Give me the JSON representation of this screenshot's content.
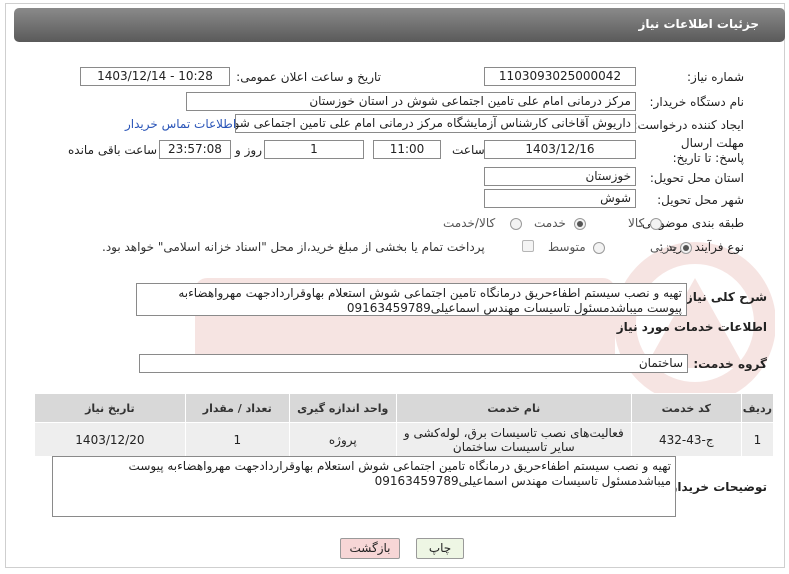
{
  "header": {
    "title": "جزئیات اطلاعات نیاز"
  },
  "fields": {
    "need_number_label": "شماره نیاز:",
    "need_number": "1103093025000042",
    "announce_label": "تاریخ و ساعت اعلان عمومی:",
    "announce_value": "1403/12/14 - 10:28",
    "buyer_org_label": "نام دستگاه خریدار:",
    "buyer_org": "مرکز درمانی امام علی تامین اجتماعی شوش در استان خوزستان",
    "requester_label": "ایجاد کننده درخواست:",
    "requester": "داریوش آقاخانی کارشناس آزمایشگاه مرکز درمانی امام علی تامین اجتماعی شوش",
    "contact_link": "اطلاعات تماس خریدار",
    "deadline_label": "مهلت ارسال پاسخ: تا تاریخ:",
    "deadline_date": "1403/12/16",
    "time_label": "ساعت",
    "deadline_time": "11:00",
    "days_value": "1",
    "days_label": "روز و",
    "remaining_time": "23:57:08",
    "remaining_label": "ساعت باقی مانده",
    "province_label": "استان محل تحویل:",
    "province": "خوزستان",
    "city_label": "شهر محل تحویل:",
    "city": "شوش",
    "category_label": "طبقه بندی موضوعی:",
    "category_options": [
      "کالا",
      "خدمت",
      "کالا/خدمت"
    ],
    "process_label": "نوع فرآیند خرید :",
    "process_options": [
      "جزیی",
      "متوسط"
    ],
    "payment_note": "پرداخت تمام یا بخشی از مبلغ خرید،از محل \"اسناد خزانه اسلامی\" خواهد بود."
  },
  "summary": {
    "label": "شرح کلی نیاز:",
    "text": "تهیه و نصب سیستم اطفاءحریق درمانگاه تامین اجتماعی شوش استعلام بهاوقراردادجهت مهرواهضاءبه پیوست میباشدمسئول تاسیسات مهندس اسماعیلی09163459789"
  },
  "services": {
    "section_title": "اطلاعات خدمات مورد نیاز",
    "group_label": "گروه خدمت:",
    "group_value": "ساختمان",
    "columns": [
      "ردیف",
      "کد خدمت",
      "نام خدمت",
      "واحد اندازه گیری",
      "تعداد / مقدار",
      "تاریخ نیاز"
    ],
    "rows": [
      {
        "row": "1",
        "code": "ج-43-432",
        "name": "فعالیت‌های نصب تاسیسات برق، لوله‌کشی و سایر تاسیسات ساختمان",
        "unit": "پروژه",
        "qty": "1",
        "date": "1403/12/20"
      }
    ]
  },
  "buyer_notes": {
    "label": "توضیحات خریدار:",
    "text": "تهیه و نصب سیستم اطفاءحریق درمانگاه تامین اجتماعی شوش استعلام بهاوقراردادجهت مهرواهضاءبه پیوست میباشدمسئول تاسیسات مهندس اسماعیلی09163459789"
  },
  "buttons": {
    "print": "چاپ",
    "back": "بازگشت"
  },
  "colors": {
    "header_bg": "#6e6e6e",
    "link": "#2a55b8",
    "back_button_bg": "#f7d6d6",
    "print_button_bg": "#eef6e4",
    "watermark": "#c0392b"
  }
}
